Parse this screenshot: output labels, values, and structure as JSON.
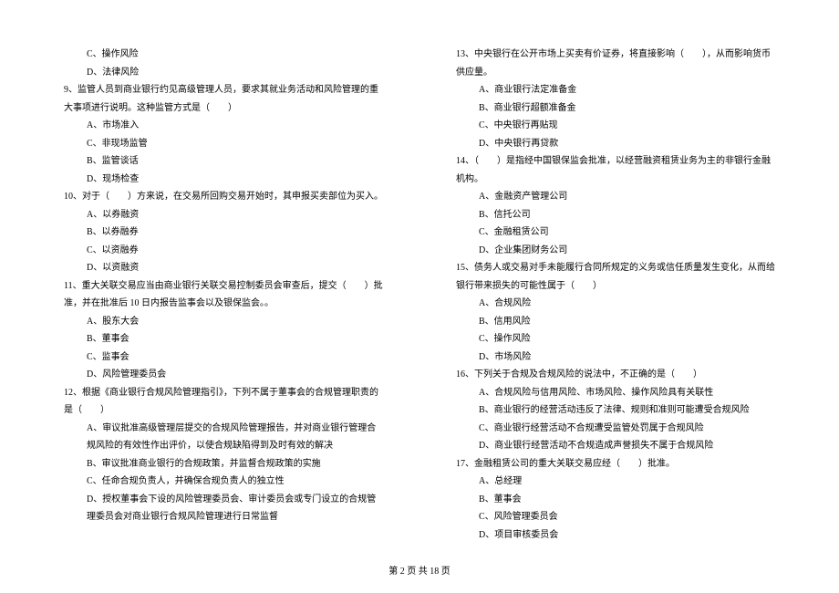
{
  "left": {
    "pre_opts": [
      "C、操作风险",
      "D、法律风险"
    ],
    "q9": "9、监管人员到商业银行约见高级管理人员，要求其就业务活动和风险管理的重大事项进行说明。这种监管方式是（　　）",
    "q9_opts": [
      "A、市场准入",
      "C、非现场监管",
      "B、监管谈话",
      "D、现场检查"
    ],
    "q10": "10、对于（　　）方来说，在交易所回购交易开始时，其申报买卖部位为买入。",
    "q10_opts": [
      "A、以券融资",
      "B、以券融券",
      "C、以资融券",
      "D、以资融资"
    ],
    "q11": "11、重大关联交易应当由商业银行关联交易控制委员会审查后，提交（　　）批准，并在批准后 10 日内报告监事会以及银保监会。。",
    "q11_opts": [
      "A、股东大会",
      "B、董事会",
      "C、监事会",
      "D、风险管理委员会"
    ],
    "q12": "12、根据《商业银行合规风险管理指引》，下列不属于董事会的合规管理职责的是（　　）",
    "q12_opts": [
      "A、审议批准高级管理层提交的合规风险管理报告，并对商业银行管理合规风险的有效性作出评价，以使合规缺陷得到及时有效的解决",
      "B、审议批准商业银行的合规政策，并监督合规政策的实施",
      "C、任命合规负责人，并确保合规负责人的独立性",
      "D、授权董事会下设的风险管理委员会、审计委员会或专门设立的合规管理委员会对商业银行合规风险管理进行日常监督"
    ]
  },
  "right": {
    "q13": "13、中央银行在公开市场上买卖有价证券，将直接影响（　　），从而影响货币供应量。",
    "q13_opts": [
      "A、商业银行法定准备金",
      "B、商业银行超额准备金",
      "C、中央银行再贴现",
      "D、中央银行再贷款"
    ],
    "q14": "14、（　　）是指经中国银保监会批准，以经营融资租赁业务为主的非银行金融机构。",
    "q14_opts": [
      "A、金融资产管理公司",
      "B、信托公司",
      "C、金融租赁公司",
      "D、企业集团财务公司"
    ],
    "q15": "15、债务人或交易对手未能履行合同所规定的义务或信任质量发生变化，从而给银行带来损失的可能性属于（　　）",
    "q15_opts": [
      "A、合规风险",
      "B、信用风险",
      "C、操作风险",
      "D、市场风险"
    ],
    "q16": "16、下列关于合规及合规风险的说法中，不正确的是（　　）",
    "q16_opts": [
      "A、合规风险与信用风险、市场风险、操作风险具有关联性",
      "B、商业银行的经营活动违反了法律、规则和准则可能遭受合规风险",
      "C、商业银行经营活动不合规遭受监管处罚属于合规风险",
      "D、商业银行经营活动不合规造成声誉损失不属于合规风险"
    ],
    "q17": "17、金融租赁公司的重大关联交易应经（　　）批准。",
    "q17_opts": [
      "A、总经理",
      "B、董事会",
      "C、风险管理委员会",
      "D、项目审核委员会"
    ]
  },
  "footer": {
    "prefix": "第 ",
    "page": "2",
    "mid": " 页 共 ",
    "total": "18",
    "suffix": " 页"
  }
}
